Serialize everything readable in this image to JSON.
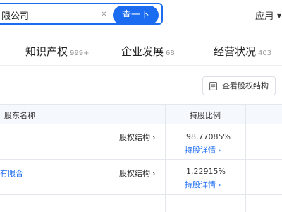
{
  "search": {
    "query": "限公司",
    "clear_icon": "close-icon",
    "button_label": "查一下"
  },
  "header": {
    "app_menu_label": "应用",
    "app_menu_icon": "caret-down-icon"
  },
  "tabs": [
    {
      "label": "知识产权",
      "count": "999+"
    },
    {
      "label": "企业发展",
      "count": "68"
    },
    {
      "label": "经营状况",
      "count": "403"
    }
  ],
  "section": {
    "view_structure_label": "查看股权结构",
    "view_structure_icon": "document-icon"
  },
  "table": {
    "columns": [
      "股东名称",
      "持股比例"
    ],
    "rows": [
      {
        "name": "",
        "equity_link": "股权结构",
        "ratio": "98.77085%",
        "detail_link": "持股详情"
      },
      {
        "name": "有限合",
        "equity_link": "股权结构",
        "ratio": "1.22915%",
        "detail_link": "持股详情"
      }
    ]
  },
  "colors": {
    "accent": "#1c6cf2",
    "header_background": "#f5f8fc",
    "border": "#e4e7ed",
    "muted_text": "#999999"
  }
}
